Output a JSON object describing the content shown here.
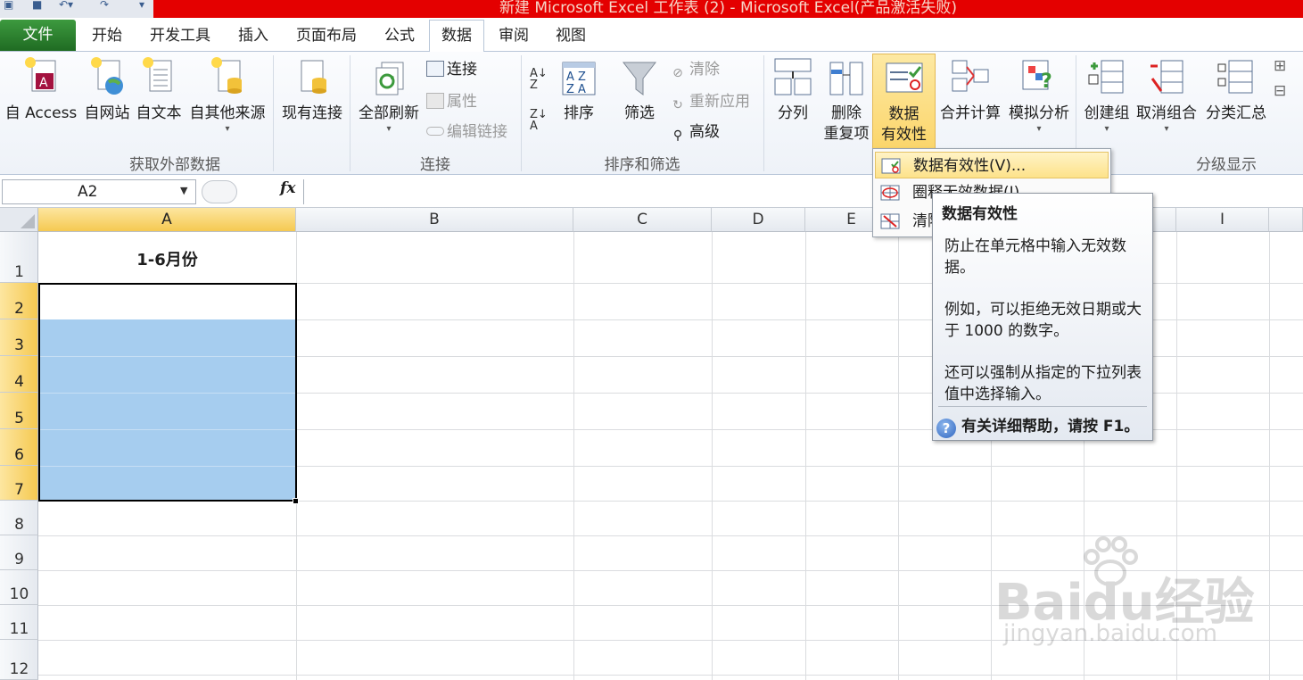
{
  "window": {
    "title": "新建 Microsoft Excel 工作表 (2) - Microsoft Excel(产品激活失败)"
  },
  "tabs": [
    {
      "label": "文件"
    },
    {
      "label": "开始"
    },
    {
      "label": "开发工具"
    },
    {
      "label": "插入"
    },
    {
      "label": "页面布局"
    },
    {
      "label": "公式"
    },
    {
      "label": "数据"
    },
    {
      "label": "审阅"
    },
    {
      "label": "视图"
    }
  ],
  "ribbon": {
    "groups": {
      "external": "获取外部数据",
      "connections": "连接",
      "sort_filter": "排序和筛选",
      "outline": "分级显示"
    },
    "buttons": {
      "from_access": "自 Access",
      "from_web": "自网站",
      "from_text": "自文本",
      "from_other": "自其他来源",
      "existing_conn": "现有连接",
      "refresh_all": "全部刷新",
      "connections": "连接",
      "properties": "属性",
      "edit_links": "编辑链接",
      "sort": "排序",
      "filter": "筛选",
      "clear": "清除",
      "reapply": "重新应用",
      "advanced": "高级",
      "text_to_cols": "分列",
      "remove_dup_1": "删除",
      "remove_dup_2": "重复项",
      "validation_1": "数据",
      "validation_2": "有效性",
      "consolidate": "合并计算",
      "whatif": "模拟分析",
      "group": "创建组",
      "ungroup": "取消组合",
      "subtotal": "分类汇总"
    }
  },
  "formula_bar": {
    "name_box": "A2",
    "fx": "fx"
  },
  "columns": [
    "A",
    "B",
    "C",
    "D",
    "E",
    "I"
  ],
  "rows": [
    "1",
    "2",
    "3",
    "4",
    "5",
    "6",
    "7",
    "8",
    "9",
    "10",
    "11",
    "12"
  ],
  "cells": {
    "A1": "1-6月份"
  },
  "dropdown": {
    "items": [
      {
        "label": "数据有效性(V)..."
      },
      {
        "label": "圈释无效数据(I)"
      },
      {
        "label": "清除"
      }
    ]
  },
  "tooltip": {
    "title": "数据有效性",
    "p1": "防止在单元格中输入无效数据。",
    "p2": "例如，可以拒绝无效日期或大于 1000 的数字。",
    "p3": "还可以强制从指定的下拉列表值中选择输入。",
    "help": "有关详细帮助，请按 F1。"
  },
  "watermark": {
    "text": "Baidu经验",
    "sub": "jingyan.baidu.com"
  },
  "colors": {
    "selection": "#a6cdef",
    "file_tab": "#2e7d32",
    "title_bar": "#e40000"
  }
}
